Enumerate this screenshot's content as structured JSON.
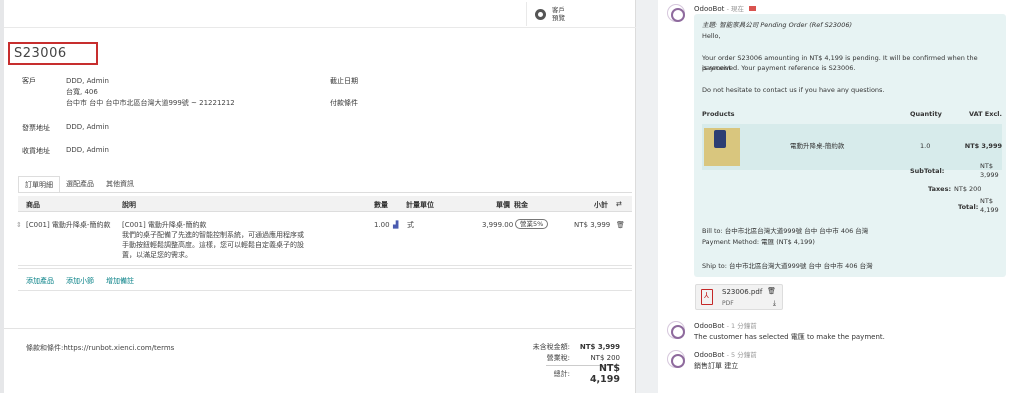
{
  "header": {
    "preview_label": "客戶預覽"
  },
  "order": {
    "name": "S23006",
    "customer_label": "客戶",
    "customer_name": "DDD, Admin",
    "customer_addr1": "台寬, 406",
    "customer_addr2": "台中市 台中 台中市北區台灣大道999號 ~ 21221212",
    "invoice_label": "發票地址",
    "invoice_value": "DDD, Admin",
    "delivery_label": "收貨地址",
    "delivery_value": "DDD, Admin",
    "expiration_label": "截止日期",
    "payment_terms_label": "付款條件"
  },
  "tabs": [
    "訂單明細",
    "選配產品",
    "其他資訊"
  ],
  "table": {
    "headers": {
      "product": "商品",
      "description": "說明",
      "quantity": "數量",
      "uom": "計量單位",
      "price": "單價",
      "taxes": "稅金",
      "subtotal": "小計"
    },
    "rows": [
      {
        "product": "[C001] 電動升降桌-簡約款",
        "description_1": "[C001] 電動升降桌-簡約款",
        "description_2": "我們的桌子配備了先進的智能控制系統，可通過應用程序或",
        "description_3": "手動按鈕輕鬆調整高度。這樣，您可以輕鬆自定義桌子的設",
        "description_4": "置，以滿足您的需求。",
        "quantity": "1.00",
        "uom": "式",
        "price": "3,999.00",
        "tax": "營業5%",
        "subtotal": "NT$ 3,999"
      }
    ],
    "add_product": "添加產品",
    "add_section": "添加小節",
    "add_note": "增加備註"
  },
  "footer": {
    "terms": "條款和條件:https://runbot.xienci.com/terms",
    "untaxed_label": "未含稅金額:",
    "untaxed_value": "NT$ 3,999",
    "tax_label": "營業稅:",
    "tax_value": "NT$ 200",
    "total_label": "總計:",
    "total_value": "NT$ 4,199"
  },
  "chatter": {
    "msg1": {
      "author": "OdooBot",
      "meta": "- 現在",
      "subject": "主題: 智能家具公司 Pending Order (Ref S23006)",
      "hello": "Hello,",
      "body1": "Your order S23006 amounting in NT$ 4,199 is pending. It will be confirmed when the payment",
      "body2": "is received. Your payment reference is S23006.",
      "body3": "Do not hesitate to contact us if you have any questions.",
      "col_products": "Products",
      "col_quantity": "Quantity",
      "col_vat": "VAT Excl.",
      "item_name": "電動升降桌-簡約款",
      "item_qty": "1.0",
      "item_price": "NT$ 3,999",
      "subtotal_label": "SubTotal:",
      "subtotal_value": "NT$ 3,999",
      "taxes_label": "Taxes:",
      "taxes_value": "NT$ 200",
      "total_label": "Total:",
      "total_value": "NT$ 4,199",
      "bill_to": "Bill to: 台中市北區台灣大道999號 台中 台中市 406 台灣",
      "payment_method": "Payment Method: 電匯 (NT$ 4,199)",
      "ship_to": "Ship to: 台中市北區台灣大道999號 台中 台中市 406 台灣"
    },
    "attachment": {
      "name": "S23006.pdf",
      "type": "PDF"
    },
    "msg2": {
      "author": "OdooBot",
      "meta": "- 1 分鐘前",
      "body": "The customer has selected 電匯 to make the payment."
    },
    "msg3": {
      "author": "OdooBot",
      "meta": "- 5 分鐘前",
      "body": "銷售訂單 建立"
    }
  }
}
